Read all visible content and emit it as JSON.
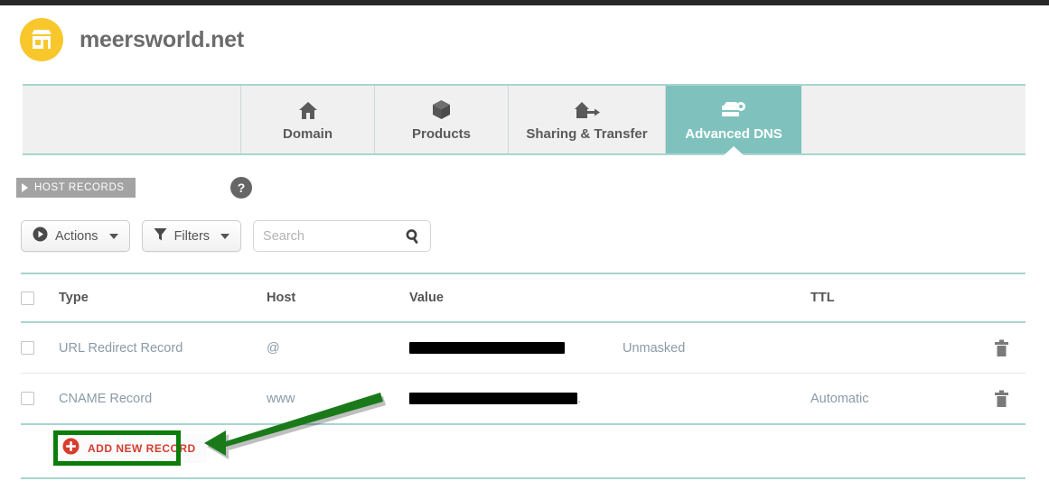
{
  "brand": {
    "logo_icon": "storefront-icon",
    "logo_bg": "#f8c72c",
    "name": "meersworld.net"
  },
  "tabs": [
    {
      "label": "Domain",
      "icon": "house-icon",
      "active": false
    },
    {
      "label": "Products",
      "icon": "box-icon",
      "active": false
    },
    {
      "label": "Sharing & Transfer",
      "icon": "house-arrow-icon",
      "active": false
    },
    {
      "label": "Advanced DNS",
      "icon": "server-gear-icon",
      "active": true
    }
  ],
  "section": {
    "banner_label": "HOST RECORDS",
    "banner_bg": "#a3a3a3",
    "help_label": "?"
  },
  "toolbar": {
    "actions_label": "Actions",
    "actions_icon": "play-circle-icon",
    "filters_label": "Filters",
    "filters_icon": "funnel-icon",
    "search_placeholder": "Search",
    "search_value": "",
    "search_icon": "search-icon"
  },
  "table": {
    "columns": [
      "Type",
      "Host",
      "Value",
      "TTL"
    ],
    "rows": [
      {
        "type": "URL Redirect Record",
        "host": "@",
        "value": "",
        "value_redacted": true,
        "extra": "Unmasked",
        "ttl": "",
        "delete_icon": "trash-icon"
      },
      {
        "type": "CNAME Record",
        "host": "www",
        "value": "",
        "value_redacted": true,
        "value_suffix": ".",
        "extra": "",
        "ttl": "Automatic",
        "delete_icon": "trash-icon"
      }
    ]
  },
  "add_record": {
    "label": "ADD NEW RECORD",
    "icon": "plus-circle-icon",
    "icon_color": "#d93c2c",
    "text_color": "#d23c2e"
  },
  "annotations": {
    "highlight_color": "#0a7d0a",
    "arrow_color": "#1a7a1a",
    "target": "ADD NEW RECORD"
  },
  "theme": {
    "accent_teal": "#7fc2bd",
    "rule_teal": "#a8d4d0",
    "row_text": "#8a9ba8",
    "header_text": "#555555"
  }
}
